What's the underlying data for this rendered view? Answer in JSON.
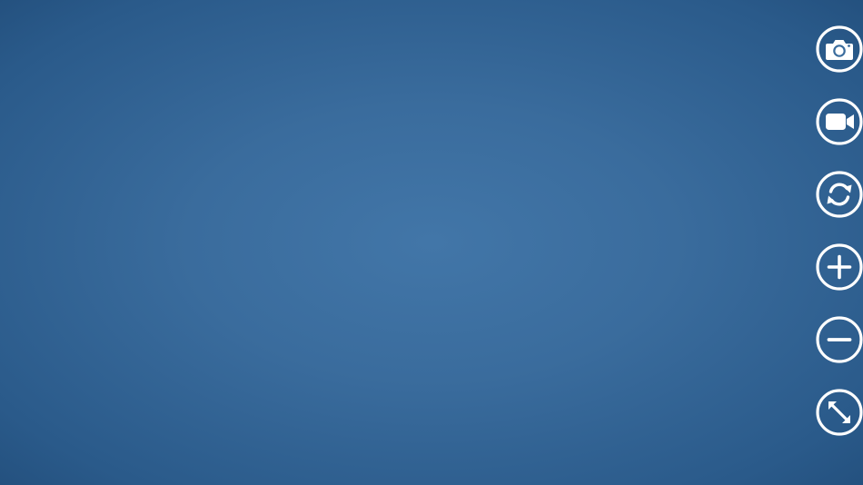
{
  "theme": {
    "background": "#3a6c9d",
    "icon_color": "#ffffff"
  },
  "toolbar": {
    "buttons": [
      {
        "name": "capture-photo",
        "icon": "camera-icon"
      },
      {
        "name": "record-video",
        "icon": "video-camera-icon"
      },
      {
        "name": "switch-camera",
        "icon": "rotate-icon"
      },
      {
        "name": "zoom-in",
        "icon": "plus-icon"
      },
      {
        "name": "zoom-out",
        "icon": "minus-icon"
      },
      {
        "name": "fullscreen",
        "icon": "expand-icon"
      }
    ]
  }
}
